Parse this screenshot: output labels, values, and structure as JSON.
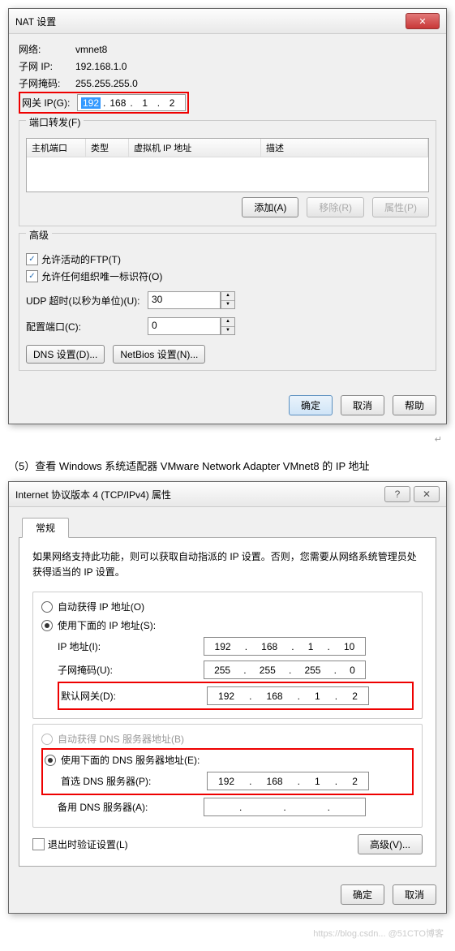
{
  "nat": {
    "title": "NAT 设置",
    "network_label": "网络:",
    "network_value": "vmnet8",
    "subnet_ip_label": "子网 IP:",
    "subnet_ip_value": "192.168.1.0",
    "subnet_mask_label": "子网掩码:",
    "subnet_mask_value": "255.255.255.0",
    "gateway_label": "网关 IP(G):",
    "gateway_ip": {
      "a": "192",
      "b": "168",
      "c": "1",
      "d": "2"
    },
    "port_forward": {
      "legend": "端口转发(F)",
      "headers": {
        "host": "主机端口",
        "type": "类型",
        "vm": "虚拟机 IP 地址",
        "desc": "描述"
      },
      "buttons": {
        "add": "添加(A)",
        "remove": "移除(R)",
        "properties": "属性(P)"
      }
    },
    "advanced": {
      "legend": "高级",
      "allow_active_ftp": "允许活动的FTP(T)",
      "allow_org_id": "允许任何组织唯一标识符(O)",
      "udp_timeout_label": "UDP 超时(以秒为单位)(U):",
      "udp_timeout_value": "30",
      "config_port_label": "配置端口(C):",
      "config_port_value": "0",
      "dns_btn": "DNS 设置(D)...",
      "netbios_btn": "NetBios 设置(N)..."
    },
    "footer": {
      "ok": "确定",
      "cancel": "取消",
      "help": "帮助"
    }
  },
  "caption": "（5）查看 Windows 系统适配器 VMware Network Adapter VMnet8 的 IP 地址",
  "ipv4": {
    "title": "Internet 协议版本 4 (TCP/IPv4) 属性",
    "tab": "常规",
    "desc": "如果网络支持此功能，则可以获取自动指派的 IP 设置。否则，您需要从网络系统管理员处获得适当的 IP 设置。",
    "auto_ip": "自动获得 IP 地址(O)",
    "use_ip": "使用下面的 IP 地址(S):",
    "ip_label": "IP 地址(I):",
    "ip_value": {
      "a": "192",
      "b": "168",
      "c": "1",
      "d": "10"
    },
    "mask_label": "子网掩码(U):",
    "mask_value": {
      "a": "255",
      "b": "255",
      "c": "255",
      "d": "0"
    },
    "gateway_label": "默认网关(D):",
    "gateway_value": {
      "a": "192",
      "b": "168",
      "c": "1",
      "d": "2"
    },
    "auto_dns": "自动获得 DNS 服务器地址(B)",
    "use_dns": "使用下面的 DNS 服务器地址(E):",
    "pref_dns_label": "首选 DNS 服务器(P):",
    "pref_dns_value": {
      "a": "192",
      "b": "168",
      "c": "1",
      "d": "2"
    },
    "alt_dns_label": "备用 DNS 服务器(A):",
    "validate_exit": "退出时验证设置(L)",
    "advanced_btn": "高级(V)...",
    "ok": "确定",
    "cancel": "取消"
  },
  "watermark": "https://blog.csdn... @51CTO博客"
}
